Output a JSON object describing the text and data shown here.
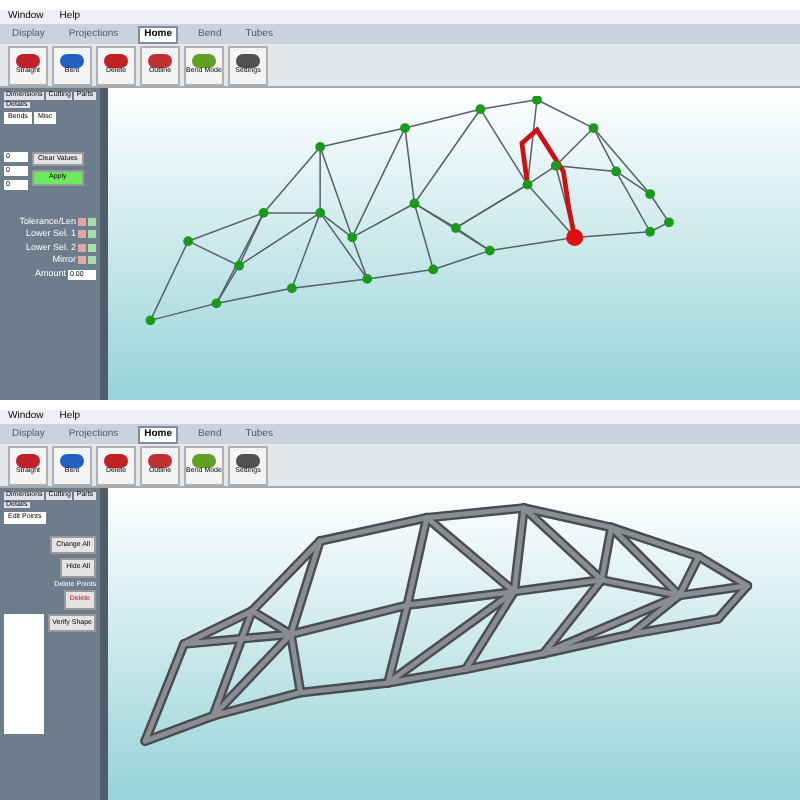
{
  "windows": [
    {
      "menu": [
        "Window",
        "Help"
      ],
      "ribbon_tabs": [
        {
          "label": "Display",
          "selected": false
        },
        {
          "label": "Projections",
          "selected": false
        },
        {
          "label": "Home",
          "selected": true
        },
        {
          "label": "Bend",
          "selected": false
        },
        {
          "label": "Tubes",
          "selected": false
        }
      ],
      "tools": [
        "Straight",
        "Bent",
        "Delete",
        "Outline",
        "Bend Mode",
        "Settings"
      ],
      "panel_tabs": [
        "Dimensions",
        "Cutting",
        "Parts",
        "Details"
      ],
      "sub_tabs": [
        "Bends",
        "Misc"
      ],
      "fields": [
        "0",
        "0",
        "0"
      ],
      "buttons": [
        "Clear Values",
        "Apply"
      ],
      "rows": [
        {
          "label": "Tolerance/Len"
        },
        {
          "label": "Lower Sel. 1"
        },
        {
          "label": "Lower Sel. 2"
        },
        {
          "label": "Mirror"
        }
      ],
      "amount": {
        "label": "Amount",
        "value": "0.00"
      },
      "kind": "wireframe"
    },
    {
      "menu": [
        "Window",
        "Help"
      ],
      "ribbon_tabs": [
        {
          "label": "Display",
          "selected": false
        },
        {
          "label": "Projections",
          "selected": false
        },
        {
          "label": "Home",
          "selected": true
        },
        {
          "label": "Bend",
          "selected": false
        },
        {
          "label": "Tubes",
          "selected": false
        }
      ],
      "tools": [
        "Straight",
        "Bent",
        "Delete",
        "Outline",
        "Bend Mode",
        "Settings"
      ],
      "panel_tabs": [
        "Dimensions",
        "Cutting",
        "Parts",
        "Details"
      ],
      "sub_tabs": [
        "Edit Points"
      ],
      "buttons": [
        "Change All",
        "Hide All"
      ],
      "group": {
        "title": "Delete Points",
        "button": "Delete"
      },
      "verify": "Verify Shape",
      "kind": "tubes"
    }
  ]
}
